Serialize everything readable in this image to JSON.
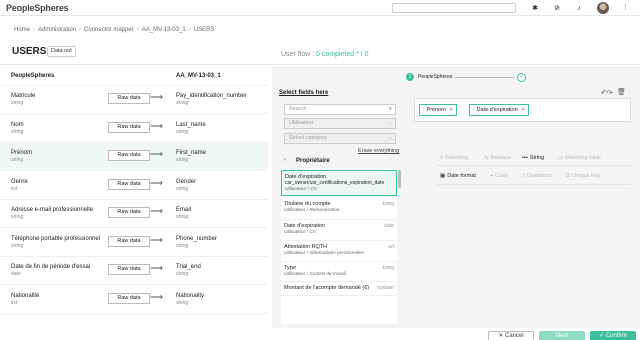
{
  "app": {
    "logo": "PeopleSpheres"
  },
  "breadcrumb": [
    "Home",
    "Administration",
    "Connector mapper",
    "AA_MV-13-03_1",
    "USERS"
  ],
  "header": {
    "title": "USERS",
    "data_out_label": "Data out",
    "user_flow_prefix": "User flow : ",
    "user_flow_status": "0 completed * / 0"
  },
  "mapping": {
    "left_header": "PeopleSpheres",
    "right_header": "AA_MV-13-03_1",
    "raw_label": "Raw data",
    "rows": [
      {
        "source": "Matricule",
        "source_type": "string",
        "target": "Pay_identification_number",
        "target_type": "string"
      },
      {
        "source": "Nom",
        "source_type": "string",
        "target": "Last_name",
        "target_type": "string"
      },
      {
        "source": "Prénom",
        "source_type": "string",
        "target": "First_name",
        "target_type": "string"
      },
      {
        "source": "Genre",
        "source_type": "list",
        "target": "Gender",
        "target_type": "string"
      },
      {
        "source": "Adresse e-mail professionnelle",
        "source_type": "string",
        "target": "Email",
        "target_type": "string"
      },
      {
        "source": "Téléphone portable professionnel",
        "source_type": "string",
        "target": "Phone_number",
        "target_type": "string"
      },
      {
        "source": "Date de fin de période d'essai",
        "source_type": "date",
        "target": "Trial_end",
        "target_type": "string"
      },
      {
        "source": "Nationalité",
        "source_type": "list",
        "target": "Nationality",
        "target_type": "string"
      }
    ]
  },
  "stepper": {
    "step_number": "1",
    "step_label": "PeopleSpheres",
    "check": "✓"
  },
  "picker": {
    "title": "Select fields here",
    "search_placeholder": "Search",
    "entity_value": "Utilisateur",
    "category_placeholder": "Select category",
    "erase_label": "Erase everything",
    "section_label": "Propriétaire",
    "items": [
      {
        "name": "Date d'expiration",
        "path": "car_owner/usr_certifications_expiration_date",
        "path2": "Utilisateur / CV",
        "type": ""
      },
      {
        "name": "Titulaire du compte",
        "path": "Utilisateur / Rémunération",
        "path2": "",
        "type": "string"
      },
      {
        "name": "Date d'expiration",
        "path": "Utilisateur / CV",
        "path2": "",
        "type": "date"
      },
      {
        "name": "Attestation RQTH",
        "path": "Utilisateur / Informations personnelles",
        "path2": "",
        "type": "url"
      },
      {
        "name": "Type",
        "path": "Utilisateur / Contrat de travail",
        "path2": "",
        "type": "string"
      },
      {
        "name": "Montant de l'acompte demandé (€)",
        "path": "",
        "path2": "",
        "type": "number"
      }
    ]
  },
  "formula": {
    "chips": [
      "Prénom",
      "Date d'expiration"
    ],
    "chip_close": "×",
    "undo_glyph": "↶↷",
    "trash_glyph": "🗑"
  },
  "operations": {
    "row1": [
      {
        "icon": "≡",
        "label": "Substring",
        "enabled": false
      },
      {
        "icon": "⇆",
        "label": "Replace",
        "enabled": false
      },
      {
        "icon": "•••",
        "label": "String",
        "enabled": true
      },
      {
        "icon": "▭",
        "label": "Matching table",
        "enabled": false
      }
    ],
    "row2": [
      {
        "icon": "▦",
        "label": "Date format",
        "enabled": true
      },
      {
        "icon": "⌖",
        "label": "Case",
        "enabled": false
      },
      {
        "icon": "±",
        "label": "Operators",
        "enabled": false
      },
      {
        "icon": "⚿",
        "label": "Unique Key",
        "enabled": false
      }
    ]
  },
  "footer": {
    "cancel": "✕ Cancel",
    "next": "Next",
    "confirm": "✓ Confirm"
  },
  "colors": {
    "accent": "#3cbf9b",
    "accent_light": "#8fdcc2",
    "panel_bg": "#f4f4f4"
  }
}
